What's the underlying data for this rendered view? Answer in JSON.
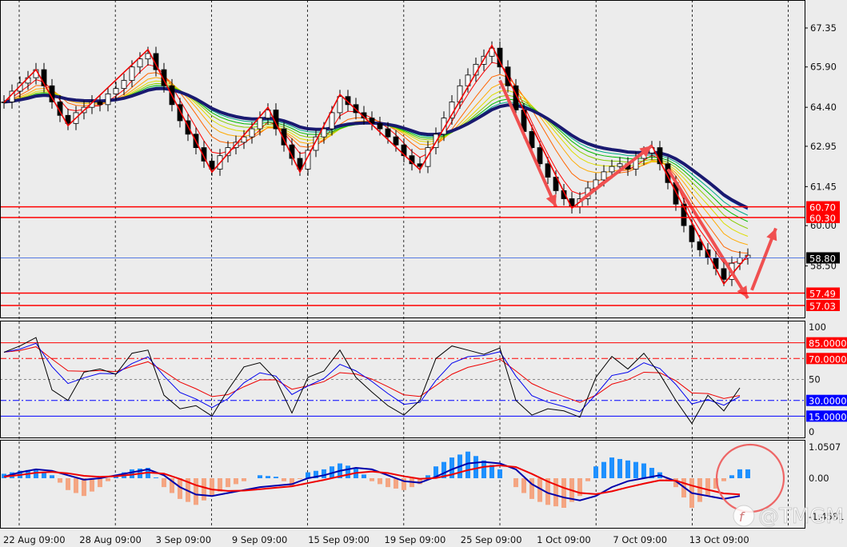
{
  "chart_data": {
    "type": "candlestick",
    "x_ticks": [
      "22 Aug 09:00",
      "28 Aug 09:00",
      "3 Sep 09:00",
      "9 Sep 09:00",
      "15 Sep 09:00",
      "19 Sep 09:00",
      "25 Sep 09:00",
      "1 Oct 09:00",
      "7 Oct 09:00",
      "13 Oct 09:00"
    ],
    "price_pane": {
      "ylim": [
        56.6,
        68.4
      ],
      "y_ticks": [
        "67.35",
        "65.90",
        "64.40",
        "62.95",
        "61.45",
        "60.00",
        "58.50"
      ],
      "close": [
        64.6,
        65.0,
        65.3,
        65.5,
        65.8,
        65.2,
        64.6,
        64.1,
        63.8,
        64.2,
        64.4,
        64.6,
        64.5,
        64.9,
        65.1,
        65.4,
        65.9,
        66.2,
        66.4,
        65.8,
        65.2,
        64.5,
        63.9,
        63.4,
        62.9,
        62.4,
        62.1,
        62.6,
        62.9,
        63.1,
        63.3,
        63.6,
        64.0,
        64.3,
        63.6,
        63.0,
        62.5,
        62.1,
        62.8,
        63.3,
        63.6,
        64.2,
        64.8,
        64.5,
        64.2,
        64.0,
        63.8,
        63.6,
        63.3,
        63.0,
        62.6,
        62.3,
        62.2,
        62.9,
        63.4,
        64.0,
        64.6,
        65.2,
        65.6,
        66.0,
        66.3,
        66.6,
        65.9,
        65.2,
        64.3,
        63.5,
        62.9,
        62.3,
        61.8,
        61.3,
        61.0,
        60.7,
        61.0,
        61.4,
        61.7,
        62.0,
        62.2,
        62.3,
        62.1,
        62.5,
        62.7,
        62.9,
        62.3,
        61.6,
        60.8,
        60.0,
        59.4,
        59.1,
        58.8,
        58.4,
        58.0,
        58.6,
        58.8,
        58.9
      ],
      "zigzag": [
        [
          0,
          64.58
        ],
        [
          4,
          65.8
        ],
        [
          8,
          63.72
        ],
        [
          18,
          66.55
        ],
        [
          26,
          61.99
        ],
        [
          33,
          64.4
        ],
        [
          37,
          61.99
        ],
        [
          42,
          64.88
        ],
        [
          52,
          62.08
        ],
        [
          61,
          66.7
        ],
        [
          71,
          60.65
        ],
        [
          81,
          62.97
        ],
        [
          90,
          57.83
        ],
        [
          93,
          58.9
        ]
      ],
      "arrows": [
        [
          [
            62,
            65.4
          ],
          [
            69,
            60.7
          ]
        ],
        [
          [
            72,
            60.9
          ],
          [
            81,
            62.97
          ]
        ],
        [
          [
            83,
            62.1
          ],
          [
            93,
            57.3
          ]
        ],
        [
          [
            93.5,
            57.6
          ],
          [
            96.5,
            59.9
          ]
        ]
      ],
      "levels": [
        {
          "value": 60.7,
          "label": "60.70",
          "color": "#ff0000"
        },
        {
          "value": 60.3,
          "label": "60.30",
          "color": "#ff0000"
        },
        {
          "value": 58.8,
          "label": "58.80",
          "color": "#4169e1",
          "tag": "#000000"
        },
        {
          "value": 57.49,
          "label": "57.49",
          "color": "#ff0000"
        },
        {
          "value": 57.03,
          "label": "57.03",
          "color": "#ff0000"
        }
      ],
      "ribbon_colors": [
        "#ff0000",
        "#ff6600",
        "#ffaa00",
        "#dddd00",
        "#88cc00",
        "#00bb00",
        "#00aa88",
        "#0088ff"
      ],
      "ma_color": "#191970"
    },
    "stochastic_pane": {
      "ylim": [
        0,
        100
      ],
      "y_ticks": [
        "100",
        "50",
        "0"
      ],
      "main_line": [
        76,
        82,
        90,
        40,
        30,
        57,
        60,
        55,
        75,
        78,
        35,
        22,
        25,
        15,
        40,
        62,
        66,
        50,
        18,
        52,
        58,
        78,
        52,
        38,
        25,
        16,
        30,
        70,
        82,
        78,
        74,
        80,
        30,
        16,
        22,
        20,
        14,
        52,
        72,
        60,
        75,
        55,
        30,
        8,
        35,
        20,
        42
      ],
      "levels": [
        {
          "value": 85,
          "label": "85.0000",
          "color": "#ff0000",
          "style": "solid"
        },
        {
          "value": 70,
          "label": "70.0000",
          "color": "#ff0000",
          "style": "dashdot"
        },
        {
          "value": 50,
          "label": "",
          "color": "#888888",
          "style": "dashed"
        },
        {
          "value": 30,
          "label": "30.0000",
          "color": "#0000ff",
          "style": "dashdot"
        },
        {
          "value": 15,
          "label": "15.0000",
          "color": "#0000ff",
          "style": "solid"
        }
      ]
    },
    "macd_pane": {
      "ylim": [
        -1.4581,
        1.0507
      ],
      "y_ticks": [
        "1.0507",
        "0.00",
        "-1.4581"
      ],
      "histogram": [
        0.15,
        0.25,
        0.3,
        0.1,
        -0.4,
        -0.6,
        -0.3,
        0.1,
        0.3,
        0.35,
        -0.3,
        -0.7,
        -0.9,
        -0.6,
        -0.3,
        -0.1,
        0.1,
        0.05,
        -0.25,
        0.2,
        0.3,
        0.5,
        0.35,
        -0.1,
        -0.3,
        -0.4,
        -0.2,
        0.4,
        0.7,
        0.9,
        0.6,
        0.3,
        -0.3,
        -0.7,
        -0.9,
        -1.0,
        -0.6,
        0.4,
        0.7,
        0.6,
        0.5,
        0.2,
        -0.3,
        -1.0,
        -0.6,
        -0.1,
        0.3
      ],
      "main_line": [
        0.05,
        0.2,
        0.3,
        0.25,
        0.1,
        -0.05,
        0.0,
        0.1,
        0.2,
        0.3,
        0.1,
        -0.3,
        -0.55,
        -0.6,
        -0.5,
        -0.4,
        -0.3,
        -0.25,
        -0.2,
        0.0,
        0.1,
        0.25,
        0.35,
        0.3,
        0.1,
        -0.1,
        -0.15,
        0.05,
        0.3,
        0.5,
        0.55,
        0.5,
        0.3,
        -0.2,
        -0.5,
        -0.65,
        -0.75,
        -0.6,
        -0.3,
        -0.1,
        0.0,
        0.1,
        -0.1,
        -0.5,
        -0.6,
        -0.7,
        -0.6
      ],
      "pos_color": "#1e90ff",
      "neg_color": "#f4a582",
      "main_color": "#0000aa",
      "signal_color": "#ee0000"
    }
  },
  "watermark": "@TMGM"
}
